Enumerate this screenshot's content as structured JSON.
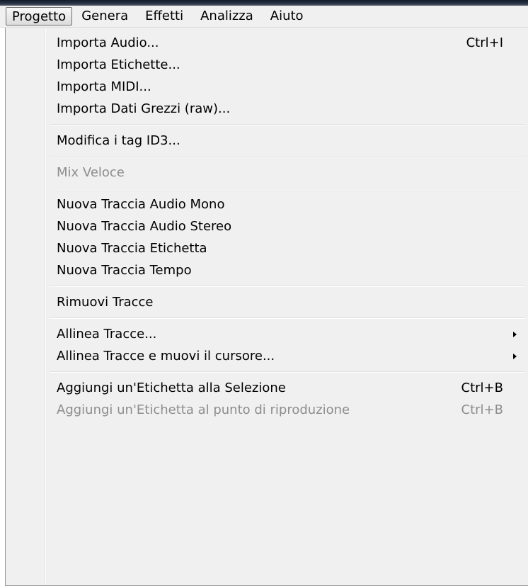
{
  "menubar": {
    "items": [
      {
        "label": "Progetto",
        "open": true
      },
      {
        "label": "Genera"
      },
      {
        "label": "Effetti"
      },
      {
        "label": "Analizza"
      },
      {
        "label": "Aiuto"
      }
    ]
  },
  "menu": {
    "groups": [
      [
        {
          "label": "Importa Audio...",
          "shortcut": "Ctrl+I"
        },
        {
          "label": "Importa Etichette..."
        },
        {
          "label": "Importa MIDI..."
        },
        {
          "label": "Importa Dati Grezzi (raw)..."
        }
      ],
      [
        {
          "label": "Modifica i tag ID3..."
        }
      ],
      [
        {
          "label": "Mix Veloce",
          "disabled": true
        }
      ],
      [
        {
          "label": "Nuova Traccia Audio Mono"
        },
        {
          "label": "Nuova Traccia Audio Stereo"
        },
        {
          "label": "Nuova Traccia Etichetta"
        },
        {
          "label": "Nuova Traccia Tempo"
        }
      ],
      [
        {
          "label": "Rimuovi Tracce"
        }
      ],
      [
        {
          "label": "Allinea Tracce...",
          "submenu": true
        },
        {
          "label": "Allinea Tracce e muovi il cursore...",
          "submenu": true
        }
      ],
      [
        {
          "label": "Aggiungi un'Etichetta alla Selezione",
          "shortcut": "Ctrl+B"
        },
        {
          "label": "Aggiungi un'Etichetta al punto di riproduzione",
          "shortcut": "Ctrl+B",
          "disabled": true
        }
      ]
    ]
  },
  "icons": {
    "submenu_arrow": "chevron-right-icon"
  }
}
